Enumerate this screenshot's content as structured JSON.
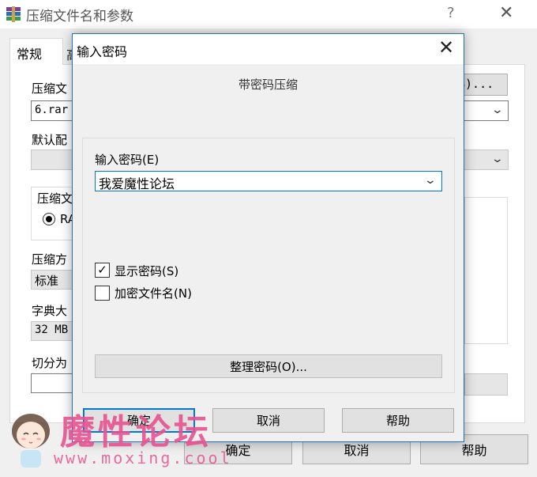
{
  "background_window": {
    "title": "压缩文件名和参数",
    "help_glyph": "?",
    "close_glyph": "✕",
    "tabs": [
      {
        "label": "常规"
      },
      {
        "label": "高"
      }
    ],
    "archive_name_label": "压缩文",
    "archive_name_value": "6.rar",
    "browse_button": "B)...",
    "default_profile_label": "默认配",
    "archive_format_group": "压缩文",
    "format_radio_label": "RA",
    "method_label": "压缩方",
    "method_value": "标准",
    "dict_label": "字典大",
    "dict_value": "32 MB",
    "split_label": "切分为",
    "ok_button": "确定",
    "cancel_button": "取消",
    "help_button": "帮助"
  },
  "dialog": {
    "title": "输入密码",
    "close_glyph": "✕",
    "header": "带密码压缩",
    "password_label": "输入密码(E)",
    "password_value": "我爱魔性论坛",
    "show_password_label": "显示密码(S)",
    "show_password_checked": true,
    "encrypt_names_label": "加密文件名(N)",
    "encrypt_names_checked": false,
    "organize_button": "整理密码(O)...",
    "ok_button": "确定",
    "cancel_button": "取消",
    "help_button": "帮助"
  },
  "watermark": {
    "text": "魔性论坛",
    "url": "www.moxing.cool"
  },
  "colors": {
    "accent": "#0078d7",
    "dialog_border": "#1f74b8",
    "watermark": "#e8528f"
  }
}
